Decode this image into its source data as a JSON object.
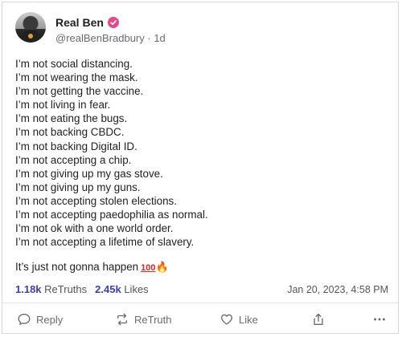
{
  "post": {
    "display_name": "Real Ben",
    "handle": "@realBenBradbury",
    "age": "· 1d",
    "lines": [
      "I’m not social distancing.",
      "I’m not wearing the mask.",
      "I’m not getting the vaccine.",
      "I’m not living in fear.",
      "I’m not eating the bugs.",
      "I’m not backing CBDC.",
      "I’m not backing Digital ID.",
      "I’m not accepting a chip.",
      "I’m not giving up my gas stove.",
      "I’m not giving up my guns.",
      "I’m not accepting stolen elections.",
      "I’m not accepting paedophilia as normal.",
      "I’m not ok with a one world order.",
      "I’m not accepting a lifetime of slavery."
    ],
    "closing_text": "It’s just not gonna happen",
    "closing_emoji_100": "100",
    "closing_emoji_fire": "🔥",
    "retruths_count": "1.18k",
    "retruths_label": "ReTruths",
    "likes_count": "2.45k",
    "likes_label": "Likes",
    "timestamp": "Jan 20, 2023, 4:58 PM"
  },
  "actions": {
    "reply": "Reply",
    "retruth": "ReTruth",
    "like": "Like"
  },
  "icons": {
    "verified": "verified-badge-icon",
    "reply": "speech-bubble-icon",
    "retruth": "repost-arrows-icon",
    "like": "heart-icon",
    "share": "share-upload-icon",
    "more": "ellipsis-icon"
  },
  "colors": {
    "verified": "#e14a8b",
    "stats_number": "#3d3db3"
  }
}
